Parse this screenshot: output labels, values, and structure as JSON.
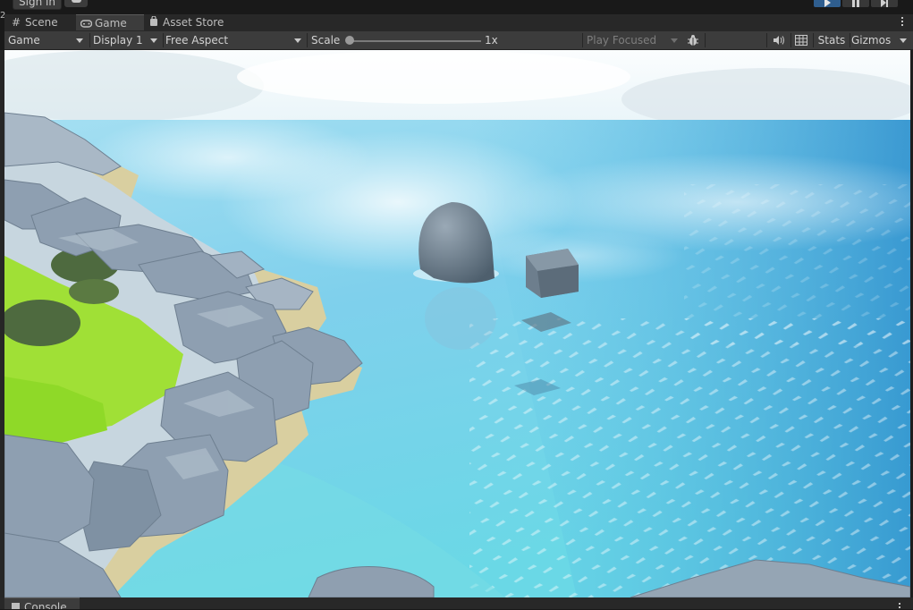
{
  "topbar": {
    "signin_label": "Sign in",
    "edge_mark": "2"
  },
  "tabs": [
    {
      "label": "Scene",
      "icon": "grid-hash-icon",
      "active": false
    },
    {
      "label": "Game",
      "icon": "gamepad-icon",
      "active": true
    },
    {
      "label": "Asset Store",
      "icon": "shopping-bag-icon",
      "active": false
    }
  ],
  "toolbar": {
    "view_mode": "Game",
    "display": "Display 1",
    "aspect": "Free Aspect",
    "scale_label": "Scale",
    "scale_value": "1x",
    "scale_fraction": 0.0,
    "play_focused": "Play Focused",
    "stats_label": "Stats",
    "gizmos_label": "Gizmos"
  },
  "bottom": {
    "console_label": "Console"
  },
  "colors": {
    "editor_bg": "#282828",
    "toolbar_bg": "#3c3c3c",
    "play_active": "#2f5e8f",
    "sky": "#eef8fb",
    "water_light": "#7fd4ec",
    "water_dark": "#2f93c9",
    "rock": "#8fa1b3",
    "grass": "#9be22a"
  }
}
